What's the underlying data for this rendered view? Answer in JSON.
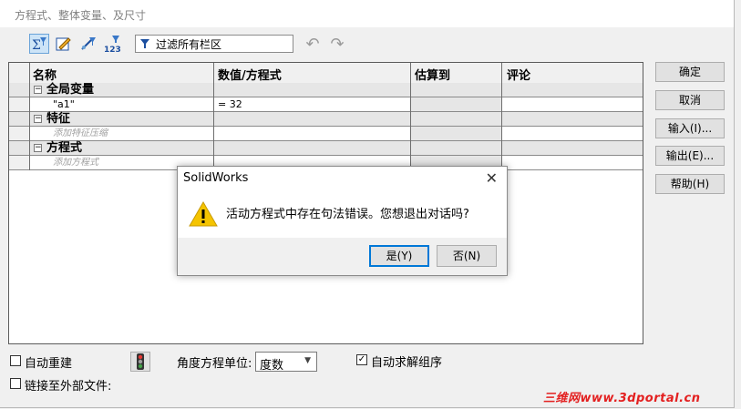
{
  "window": {
    "title": "方程式、整体变量、及尺寸"
  },
  "toolbar": {
    "buttons": [
      {
        "icon": "equation-view-icon",
        "label": "Σ"
      },
      {
        "icon": "sketch-equation-icon",
        "label": ""
      },
      {
        "icon": "dimension-view-icon",
        "label": ""
      },
      {
        "icon": "ordered-view-icon",
        "label": "123"
      }
    ],
    "filter_text": "过滤所有栏区"
  },
  "table": {
    "columns": [
      "名称",
      "数值/方程式",
      "估算到",
      "评论"
    ],
    "global_vars_label": "全局变量",
    "a1_name": "\"a1\"",
    "a1_value": "= 32",
    "features_label": "特征",
    "features_placeholder": "添加特征压缩",
    "equations_label": "方程式",
    "equations_placeholder": "添加方程式"
  },
  "side_buttons": {
    "ok": "确定",
    "cancel": "取消",
    "import": "输入(I)...",
    "export": "输出(E)...",
    "help": "帮助(H)"
  },
  "bottom": {
    "auto_rebuild": "自动重建",
    "angle_unit_label": "角度方程单位:",
    "angle_unit_value": "度数",
    "auto_solve": "自动求解组序",
    "link_external": "链接至外部文件:"
  },
  "dialog": {
    "title": "SolidWorks",
    "message": "活动方程式中存在句法错误。您想退出对话吗?",
    "yes": "是(Y)",
    "no": "否(N)"
  },
  "watermark": "三维网www.3dportal.cn",
  "colors": {
    "accent": "#0078d7",
    "warning": "#f5c400",
    "watermark": "#e32020"
  }
}
